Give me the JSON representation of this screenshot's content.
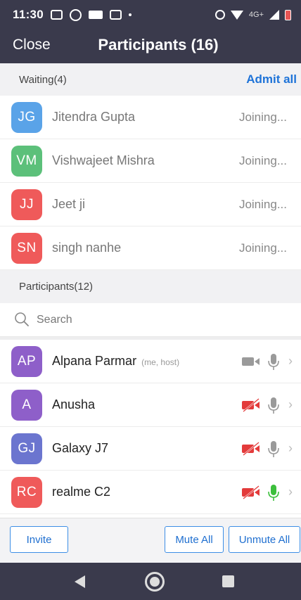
{
  "status_bar": {
    "time": "11:30",
    "lte_label": "4G+"
  },
  "header": {
    "close_label": "Close",
    "title": "Participants (16)"
  },
  "waiting": {
    "section_label": "Waiting(4)",
    "admit_all_label": "Admit all",
    "items": [
      {
        "initials": "JG",
        "name": "Jitendra Gupta",
        "status": "Joining...",
        "color": "#5aa3e8"
      },
      {
        "initials": "VM",
        "name": "Vishwajeet Mishra",
        "status": "Joining...",
        "color": "#5cc07a"
      },
      {
        "initials": "JJ",
        "name": "Jeet ji",
        "status": "Joining...",
        "color": "#ef5a5a"
      },
      {
        "initials": "SN",
        "name": "singh nanhe",
        "status": "Joining...",
        "color": "#ef5a5a"
      }
    ]
  },
  "participants": {
    "section_label": "Participants(12)",
    "search_placeholder": "Search",
    "items": [
      {
        "initials": "AP",
        "name": "Alpana Parmar",
        "tag": "(me, host)",
        "video": "on",
        "mic": "muted",
        "color": "#8e5fc9"
      },
      {
        "initials": "A",
        "name": "Anusha",
        "tag": "",
        "video": "off",
        "mic": "muted",
        "color": "#8e5fc9"
      },
      {
        "initials": "GJ",
        "name": "Galaxy J7",
        "tag": "",
        "video": "off",
        "mic": "muted",
        "color": "#6b75cf"
      },
      {
        "initials": "RC",
        "name": "realme C2",
        "tag": "",
        "video": "off",
        "mic": "active",
        "color": "#ef5a5a"
      }
    ]
  },
  "footer": {
    "invite_label": "Invite",
    "mute_all_label": "Mute All",
    "unmute_all_label": "Unmute All"
  },
  "colors": {
    "header_bg": "#3a3a4c",
    "accent_blue": "#1e73d8",
    "video_off_red": "#e33b3b",
    "mic_active_green": "#3cbf3c",
    "icon_gray": "#9a9a9a"
  }
}
